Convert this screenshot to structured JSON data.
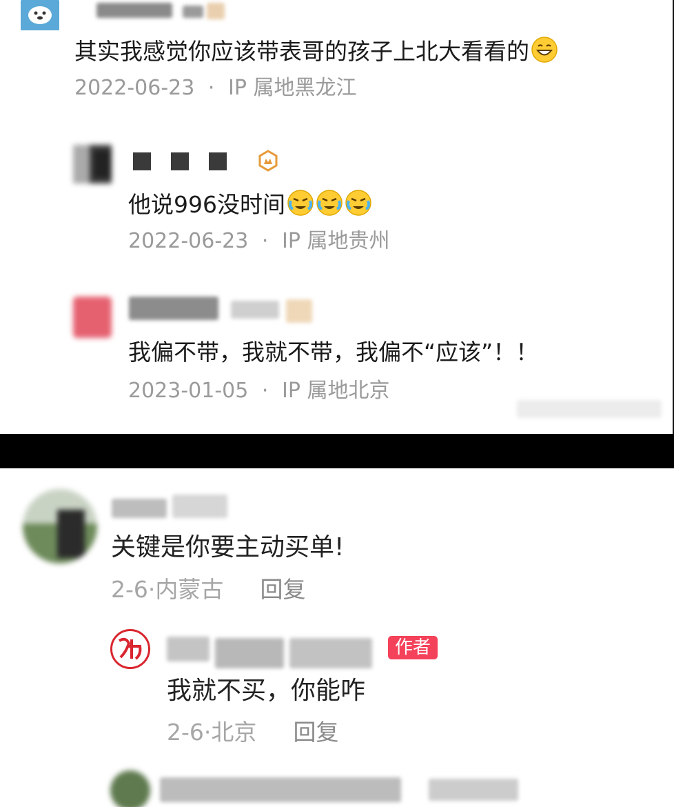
{
  "top_comments": [
    {
      "text": "其实我感觉你应该带表哥的孩子上北大看看的",
      "emoji": "grinning-face-emoji",
      "date": "2022-06-23",
      "location": "IP 属地黑龙江"
    },
    {
      "text": "他说996没时间",
      "emoji": "loudly-crying-face-emoji",
      "date": "2022-06-23",
      "location": "IP 属地贵州"
    },
    {
      "text": "我偏不带，我就不带，我偏不“应该”！！",
      "date": "2023-01-05",
      "location": "IP 属地北京"
    }
  ],
  "meta_separator": "·",
  "bottom_comments": [
    {
      "text": "关键是你要主动买单!",
      "date": "2-6·",
      "location": "内蒙古",
      "reply_label": "回复"
    },
    {
      "text": "我就不买，你能咋",
      "author_badge": "作者",
      "date": "2-6·",
      "location": "北京",
      "reply_label": "回复"
    }
  ],
  "colors": {
    "divider": "#000000",
    "author_badge": "#f5425b",
    "meta_text": "#9a9a9a"
  }
}
